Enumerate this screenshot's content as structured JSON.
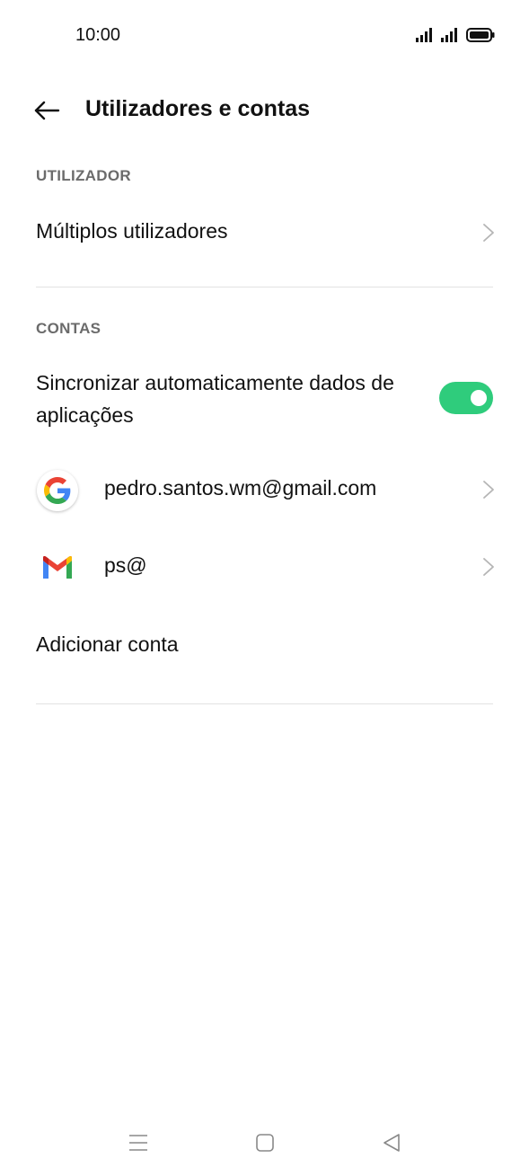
{
  "status_bar": {
    "time": "10:00",
    "icons": [
      "signal-icon",
      "signal-icon",
      "battery-icon"
    ]
  },
  "header": {
    "title": "Utilizadores e contas",
    "back_icon": "back-arrow-icon"
  },
  "sections": {
    "user": {
      "label": "UTILIZADOR",
      "multiple_users": "Múltiplos utilizadores"
    },
    "accounts": {
      "label": "CONTAS",
      "auto_sync": "Sincronizar automaticamente dados de aplicações",
      "auto_sync_enabled": true,
      "items": [
        {
          "icon": "google-icon",
          "label": "pedro.santos.wm@gmail.com"
        },
        {
          "icon": "gmail-icon",
          "label": "ps@"
        }
      ],
      "add_account": "Adicionar conta"
    }
  },
  "colors": {
    "toggle_on": "#2fcc7c",
    "section_label": "#6b6b6b"
  },
  "nav_bar": {
    "icons": [
      "menu-icon",
      "home-icon",
      "back-icon"
    ]
  }
}
